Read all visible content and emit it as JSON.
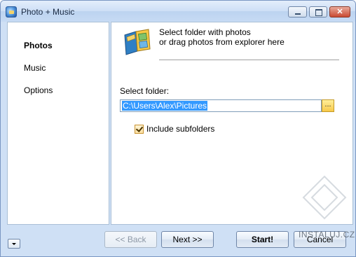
{
  "window": {
    "title": "Photo + Music"
  },
  "sidebar": {
    "items": [
      {
        "label": "Photos"
      },
      {
        "label": "Music"
      },
      {
        "label": "Options"
      }
    ]
  },
  "header": {
    "line1": "Select folder with photos",
    "line2": "or drag photos from explorer here"
  },
  "folder": {
    "label": "Select folder:",
    "value": "C:\\Users\\Alex\\Pictures",
    "browse": "..."
  },
  "subfolders": {
    "label": "Include subfolders",
    "checked": true
  },
  "buttons": {
    "back": "<< Back",
    "next": "Next >>",
    "start": "Start!",
    "cancel": "Cancel"
  },
  "watermark": "INSTALUJ.CZ",
  "colors": {
    "selection": "#3399ff",
    "frame": "#cfe0f5",
    "close": "#c94a32"
  },
  "icons": [
    "app-icon",
    "minimize-icon",
    "maximize-icon",
    "close-icon",
    "photo-album-icon",
    "folder-browse-icon",
    "dropdown-arrow-icon"
  ]
}
